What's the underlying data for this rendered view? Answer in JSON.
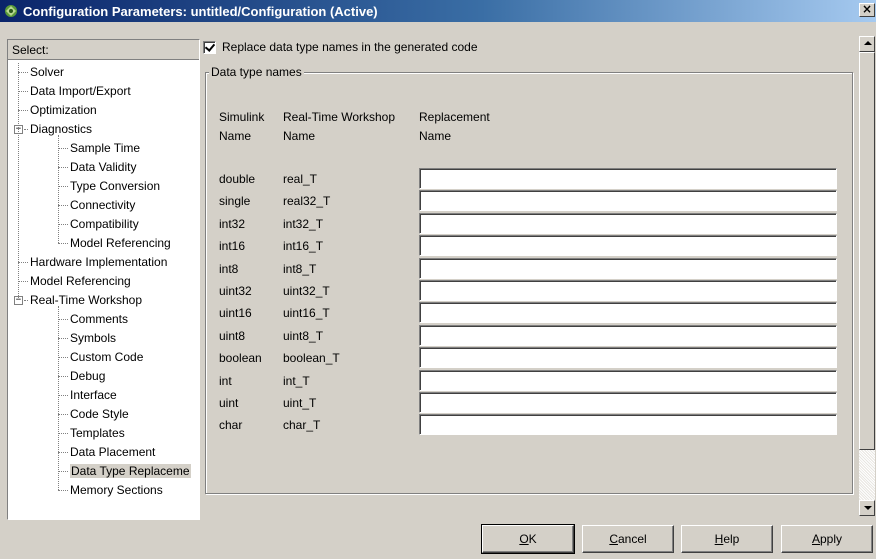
{
  "window": {
    "title": "Configuration Parameters: untitled/Configuration (Active)",
    "close_glyph": "×"
  },
  "tree": {
    "header": "Select:",
    "items": [
      {
        "label": "Solver",
        "level": 1
      },
      {
        "label": "Data Import/Export",
        "level": 1
      },
      {
        "label": "Optimization",
        "level": 1
      },
      {
        "label": "Diagnostics",
        "level": 1,
        "expanded": true
      },
      {
        "label": "Sample Time",
        "level": 2
      },
      {
        "label": "Data Validity",
        "level": 2
      },
      {
        "label": "Type Conversion",
        "level": 2
      },
      {
        "label": "Connectivity",
        "level": 2
      },
      {
        "label": "Compatibility",
        "level": 2
      },
      {
        "label": "Model Referencing",
        "level": 2
      },
      {
        "label": "Hardware Implementation",
        "level": 1
      },
      {
        "label": "Model Referencing",
        "level": 1
      },
      {
        "label": "Real-Time Workshop",
        "level": 1,
        "expanded": true
      },
      {
        "label": "Comments",
        "level": 2
      },
      {
        "label": "Symbols",
        "level": 2
      },
      {
        "label": "Custom Code",
        "level": 2
      },
      {
        "label": "Debug",
        "level": 2
      },
      {
        "label": "Interface",
        "level": 2
      },
      {
        "label": "Code Style",
        "level": 2
      },
      {
        "label": "Templates",
        "level": 2
      },
      {
        "label": "Data Placement",
        "level": 2
      },
      {
        "label": "Data Type Replaceme",
        "level": 2,
        "selected": true
      },
      {
        "label": "Memory Sections",
        "level": 2
      }
    ]
  },
  "content": {
    "replace_checkbox_label": "Replace data type names in the generated code",
    "replace_checked": true,
    "group_title": "Data type names",
    "headers": {
      "simulink": [
        "Simulink",
        "Name"
      ],
      "rtw": [
        "Real-Time Workshop",
        "Name"
      ],
      "replacement": [
        "Replacement",
        "Name"
      ]
    },
    "rows": [
      {
        "simulink": "double",
        "rtw": "real_T",
        "replacement": ""
      },
      {
        "simulink": "single",
        "rtw": "real32_T",
        "replacement": ""
      },
      {
        "simulink": "int32",
        "rtw": "int32_T",
        "replacement": ""
      },
      {
        "simulink": "int16",
        "rtw": "int16_T",
        "replacement": ""
      },
      {
        "simulink": "int8",
        "rtw": "int8_T",
        "replacement": ""
      },
      {
        "simulink": "uint32",
        "rtw": "uint32_T",
        "replacement": ""
      },
      {
        "simulink": "uint16",
        "rtw": "uint16_T",
        "replacement": ""
      },
      {
        "simulink": "uint8",
        "rtw": "uint8_T",
        "replacement": ""
      },
      {
        "simulink": "boolean",
        "rtw": "boolean_T",
        "replacement": ""
      },
      {
        "simulink": "int",
        "rtw": "int_T",
        "replacement": ""
      },
      {
        "simulink": "uint",
        "rtw": "uint_T",
        "replacement": ""
      },
      {
        "simulink": "char",
        "rtw": "char_T",
        "replacement": ""
      }
    ]
  },
  "buttons": {
    "ok": {
      "mnemonic": "O",
      "rest": "K"
    },
    "cancel": {
      "mnemonic": "C",
      "rest": "ancel"
    },
    "help": {
      "mnemonic": "H",
      "rest": "elp"
    },
    "apply": {
      "mnemonic": "A",
      "rest": "pply"
    }
  }
}
